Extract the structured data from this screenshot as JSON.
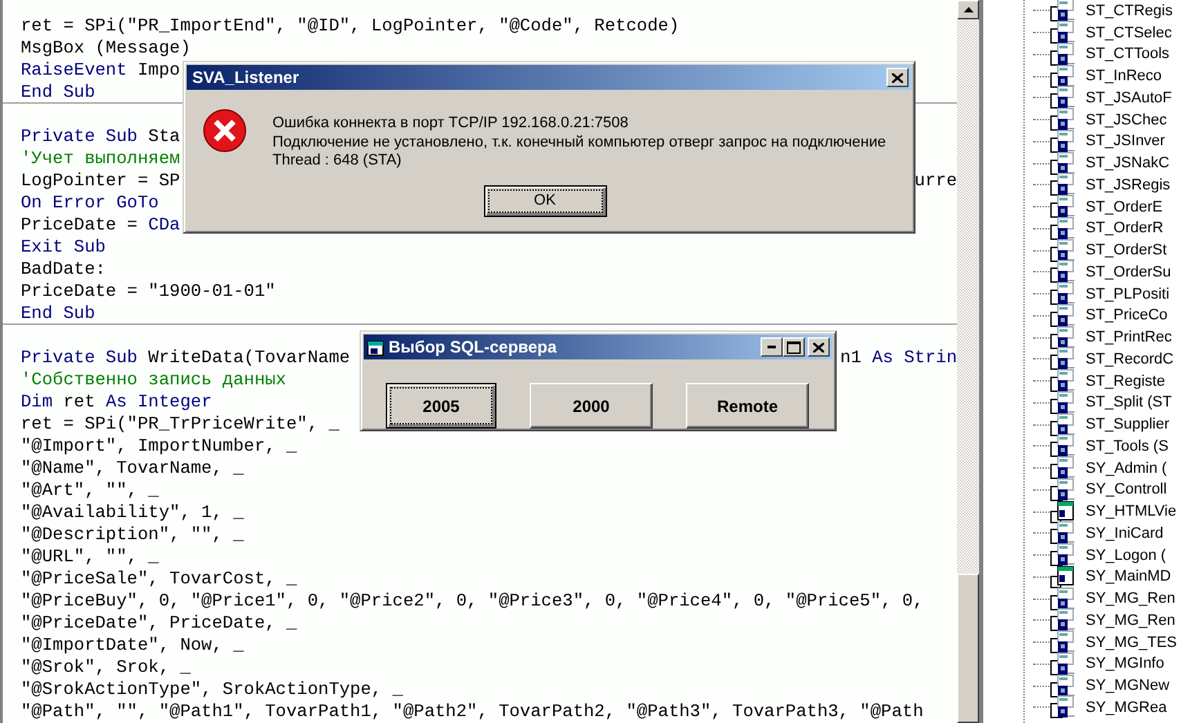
{
  "editor": {
    "procedures": [
      {
        "lines": [
          {
            "parts": [
              {
                "text": "ret = SPi(\"PR_ImportEnd\", \"@ID\", LogPointer, \"@Code\", Retcode)",
                "kind": "plain"
              }
            ]
          },
          {
            "parts": [
              {
                "text": "MsgBox (Message)",
                "kind": "plain"
              }
            ]
          },
          {
            "parts": [
              {
                "text": "RaiseEvent",
                "kind": "keyword"
              },
              {
                "text": " Impo",
                "kind": "plain"
              }
            ]
          },
          {
            "parts": [
              {
                "text": "End Sub",
                "kind": "keyword"
              }
            ]
          }
        ]
      },
      {
        "lines": [
          {
            "parts": [
              {
                "text": "Private Sub",
                "kind": "keyword"
              },
              {
                "text": " Sta",
                "kind": "plain"
              }
            ]
          },
          {
            "parts": [
              {
                "text": "'Учет выполняем",
                "kind": "comment"
              }
            ]
          },
          {
            "parts": [
              {
                "text": "LogPointer = SP",
                "kind": "plain"
              }
            ],
            "tail": [
              {
                "text": "urre",
                "kind": "plain"
              }
            ]
          },
          {
            "parts": [
              {
                "text": "On Error GoTo",
                "kind": "keyword"
              }
            ]
          },
          {
            "parts": [
              {
                "text": "PriceDate = ",
                "kind": "plain"
              },
              {
                "text": "CDa",
                "kind": "keyword"
              }
            ]
          },
          {
            "parts": [
              {
                "text": "Exit Sub",
                "kind": "keyword"
              }
            ]
          },
          {
            "parts": [
              {
                "text": "BadDate:",
                "kind": "plain"
              }
            ]
          },
          {
            "parts": [
              {
                "text": "PriceDate = \"1900-01-01\"",
                "kind": "plain"
              }
            ]
          },
          {
            "parts": [
              {
                "text": "End Sub",
                "kind": "keyword"
              }
            ]
          }
        ]
      },
      {
        "lines": [
          {
            "parts": [
              {
                "text": "Private Sub",
                "kind": "keyword"
              },
              {
                "text": " WriteData(TovarName",
                "kind": "plain"
              }
            ],
            "tail": [
              {
                "text": "n1 ",
                "kind": "plain"
              },
              {
                "text": "As Strin",
                "kind": "keyword"
              }
            ]
          },
          {
            "parts": [
              {
                "text": "'Собственно запись данных",
                "kind": "comment"
              }
            ]
          },
          {
            "parts": [
              {
                "text": "Dim",
                "kind": "keyword"
              },
              {
                "text": " ret ",
                "kind": "plain"
              },
              {
                "text": "As Integer",
                "kind": "keyword"
              }
            ]
          },
          {
            "parts": [
              {
                "text": "ret = SPi(\"PR_TrPriceWrite\", _",
                "kind": "plain"
              }
            ]
          },
          {
            "parts": [
              {
                "text": "\"@Import\", ImportNumber, _",
                "kind": "plain"
              }
            ]
          },
          {
            "parts": [
              {
                "text": "\"@Name\", TovarName, _",
                "kind": "plain"
              }
            ]
          },
          {
            "parts": [
              {
                "text": "\"@Art\", \"\", _",
                "kind": "plain"
              }
            ]
          },
          {
            "parts": [
              {
                "text": "\"@Availability\", 1, _",
                "kind": "plain"
              }
            ]
          },
          {
            "parts": [
              {
                "text": "\"@Description\", \"\", _",
                "kind": "plain"
              }
            ]
          },
          {
            "parts": [
              {
                "text": "\"@URL\", \"\", _",
                "kind": "plain"
              }
            ]
          },
          {
            "parts": [
              {
                "text": "\"@PriceSale\", TovarCost, _",
                "kind": "plain"
              }
            ]
          },
          {
            "parts": [
              {
                "text": "\"@PriceBuy\", 0, \"@Price1\", 0, \"@Price2\", 0, \"@Price3\", 0, \"@Price4\", 0, \"@Price5\", 0,",
                "kind": "plain"
              }
            ]
          },
          {
            "parts": [
              {
                "text": "\"@PriceDate\", PriceDate, _",
                "kind": "plain"
              }
            ]
          },
          {
            "parts": [
              {
                "text": "\"@ImportDate\", Now, _",
                "kind": "plain"
              }
            ]
          },
          {
            "parts": [
              {
                "text": "\"@Srok\", Srok, _",
                "kind": "plain"
              }
            ]
          },
          {
            "parts": [
              {
                "text": "\"@SrokActionType\", SrokActionType, _",
                "kind": "plain"
              }
            ]
          },
          {
            "parts": [
              {
                "text": "\"@Path\", \"\", \"@Path1\", TovarPath1, \"@Path2\", TovarPath2, \"@Path3\", TovarPath3, \"@Path",
                "kind": "plain"
              }
            ]
          }
        ]
      }
    ]
  },
  "project_tree": {
    "items": [
      {
        "label": "ST_CTRegis",
        "kind": "module"
      },
      {
        "label": "ST_CTSelec",
        "kind": "module"
      },
      {
        "label": "ST_CTTools",
        "kind": "module"
      },
      {
        "label": "ST_InReco",
        "kind": "module"
      },
      {
        "label": "ST_JSAutoF",
        "kind": "module"
      },
      {
        "label": "ST_JSChec",
        "kind": "module"
      },
      {
        "label": "ST_JSInver",
        "kind": "module"
      },
      {
        "label": "ST_JSNakC",
        "kind": "module"
      },
      {
        "label": "ST_JSRegis",
        "kind": "module"
      },
      {
        "label": "ST_OrderE",
        "kind": "module"
      },
      {
        "label": "ST_OrderR",
        "kind": "module"
      },
      {
        "label": "ST_OrderSt",
        "kind": "module"
      },
      {
        "label": "ST_OrderSu",
        "kind": "module"
      },
      {
        "label": "ST_PLPositi",
        "kind": "module"
      },
      {
        "label": "ST_PriceCo",
        "kind": "module"
      },
      {
        "label": "ST_PrintRec",
        "kind": "module"
      },
      {
        "label": "ST_RecordC",
        "kind": "module"
      },
      {
        "label": "ST_Registe",
        "kind": "module"
      },
      {
        "label": "ST_Split (ST",
        "kind": "module"
      },
      {
        "label": "ST_Supplier",
        "kind": "module"
      },
      {
        "label": "ST_Tools (S",
        "kind": "module"
      },
      {
        "label": "SY_Admin (",
        "kind": "module"
      },
      {
        "label": "SY_Controll",
        "kind": "module"
      },
      {
        "label": "SY_HTMLVie",
        "kind": "form"
      },
      {
        "label": "SY_IniCard",
        "kind": "module"
      },
      {
        "label": "SY_Logon (",
        "kind": "module"
      },
      {
        "label": "SY_MainMD",
        "kind": "form"
      },
      {
        "label": "SY_MG_Ren",
        "kind": "module"
      },
      {
        "label": "SY_MG_Ren",
        "kind": "module"
      },
      {
        "label": "SY_MG_TES",
        "kind": "module"
      },
      {
        "label": "SY_MGInfo",
        "kind": "module"
      },
      {
        "label": "SY_MGNew",
        "kind": "module"
      },
      {
        "label": "SY_MGRea",
        "kind": "module"
      }
    ]
  },
  "error_dialog": {
    "title": "SVA_Listener",
    "message_lines": [
      "Ошибка коннекта в порт TCP/IP 192.168.0.21:7508",
      "Подключение не установлено, т.к. конечный компьютер отверг запрос на подключение",
      "Thread : 648 (STA)"
    ],
    "button": "OK"
  },
  "sql_dialog": {
    "title": "Выбор SQL-сервера",
    "buttons": [
      {
        "label": "2005",
        "default": true
      },
      {
        "label": "2000",
        "default": false
      },
      {
        "label": "Remote",
        "default": false
      }
    ]
  }
}
